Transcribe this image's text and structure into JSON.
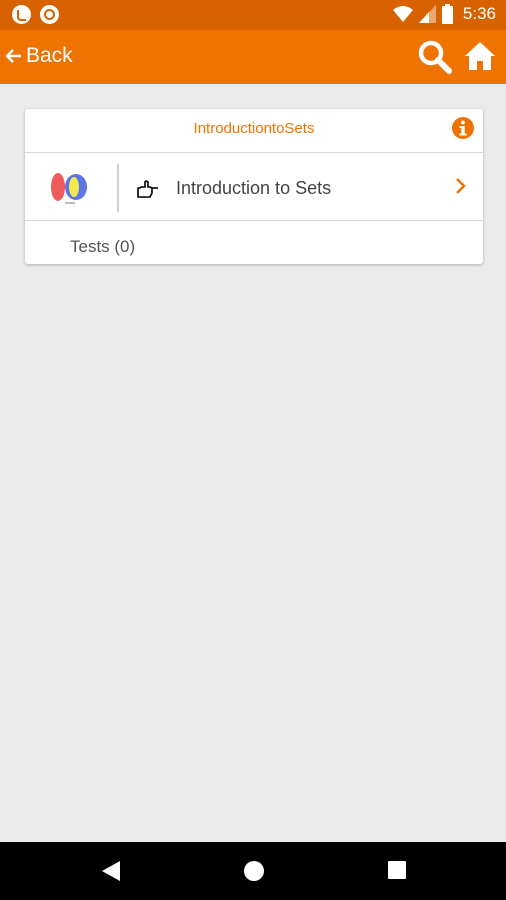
{
  "status_bar": {
    "time": "5:36",
    "left_icons": [
      "music-icon",
      "record-icon"
    ],
    "right_icons": [
      "wifi-icon",
      "signal-icon",
      "battery-icon"
    ]
  },
  "app_bar": {
    "back_label": "Back",
    "icons": [
      "search-icon",
      "home-icon"
    ],
    "color": "#ef7300"
  },
  "card": {
    "title": "IntroductiontoSets",
    "topic": {
      "label": "Introduction to Sets",
      "thumbnail": "venn-diagram-thumbnail",
      "icon": "hand-pointer-icon"
    },
    "tests_label": "Tests (0)"
  },
  "nav_bar": {
    "buttons": [
      "back-triangle-icon",
      "home-circle-icon",
      "recents-square-icon"
    ]
  },
  "colors": {
    "accent": "#ef7300",
    "status_bar": "#d86200",
    "background": "#ecebec"
  }
}
